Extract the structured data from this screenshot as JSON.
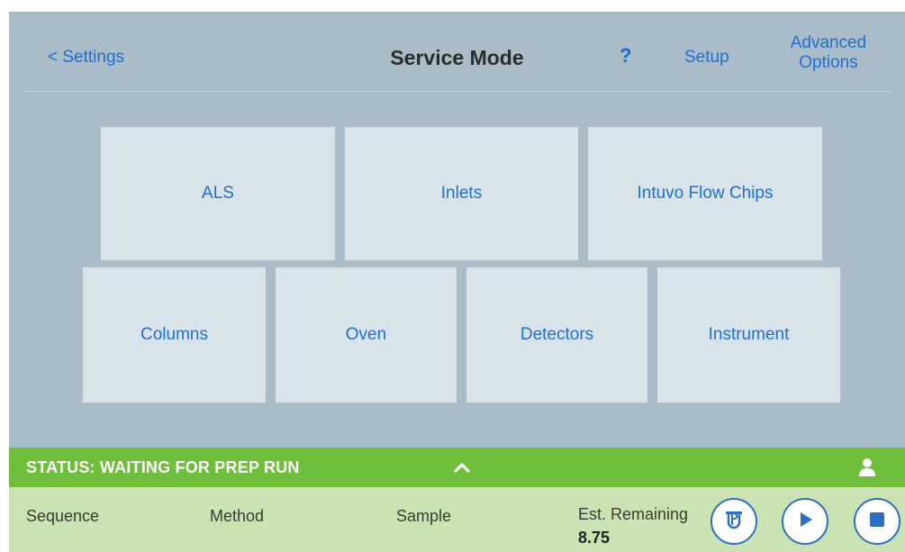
{
  "header": {
    "back_label": "< Settings",
    "title": "Service Mode",
    "help_label": "?",
    "setup_label": "Setup",
    "advanced_line1": "Advanced",
    "advanced_line2": "Options"
  },
  "tiles": [
    {
      "label": "ALS"
    },
    {
      "label": "Inlets"
    },
    {
      "label": "Intuvo Flow Chips"
    },
    {
      "label": "Columns"
    },
    {
      "label": "Oven"
    },
    {
      "label": "Detectors"
    },
    {
      "label": "Instrument"
    }
  ],
  "status": {
    "text": "STATUS: WAITING FOR PREP RUN",
    "expand_icon": "chevron-up-icon",
    "user_icon": "user-icon"
  },
  "info": {
    "sequence_label": "Sequence",
    "method_label": "Method",
    "sample_label": "Sample",
    "est_label": "Est. Remaining",
    "est_value": "8.75"
  },
  "colors": {
    "background": "#a9bcc8",
    "tile": "#d9e3ea",
    "link": "#1f6fd1",
    "status_green": "#6fbe3c",
    "info_green": "#c9e3b3"
  }
}
